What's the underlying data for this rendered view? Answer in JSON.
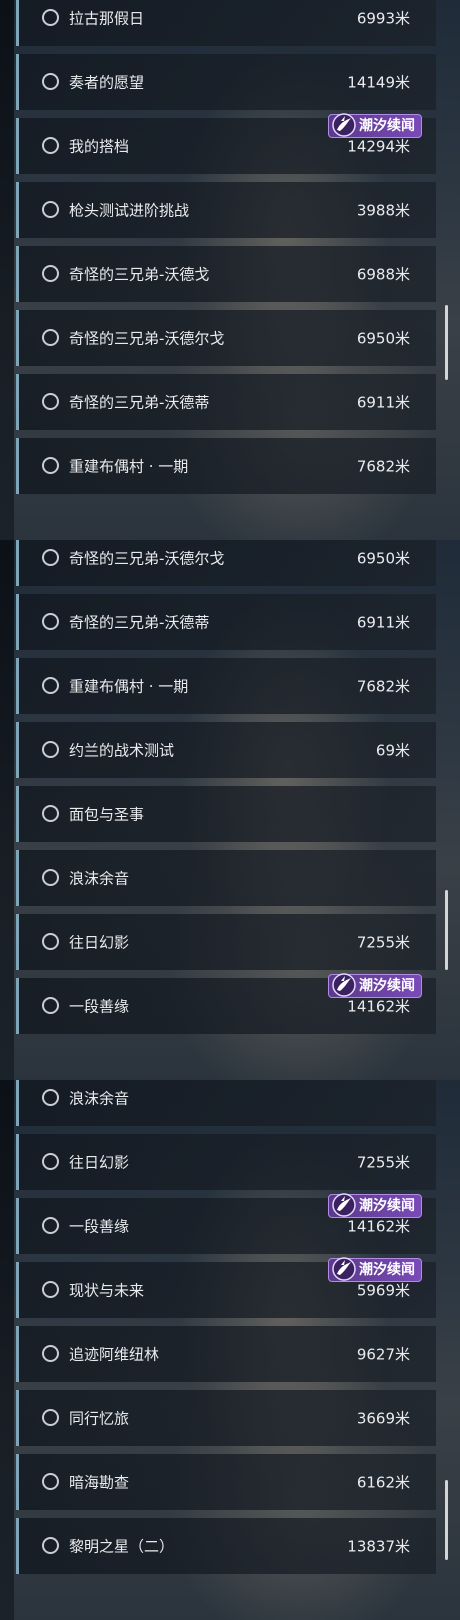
{
  "panels": [
    {
      "rows": [
        {
          "name": "拉古那假日",
          "distance": "6993米"
        },
        {
          "name": "奏者的愿望",
          "distance": "14149米"
        },
        {
          "name": "我的搭档",
          "distance": "14294米",
          "badge": "潮汐续闻"
        },
        {
          "name": "枪头测试进阶挑战",
          "distance": "3988米"
        },
        {
          "name": "奇怪的三兄弟-沃德戈",
          "distance": "6988米"
        },
        {
          "name": "奇怪的三兄弟-沃德尔戈",
          "distance": "6950米"
        },
        {
          "name": "奇怪的三兄弟-沃德蒂",
          "distance": "6911米"
        },
        {
          "name": "重建布偶村 · 一期",
          "distance": "7682米"
        }
      ]
    },
    {
      "rows": [
        {
          "name": "奇怪的三兄弟-沃德尔戈",
          "distance": "6950米"
        },
        {
          "name": "奇怪的三兄弟-沃德蒂",
          "distance": "6911米"
        },
        {
          "name": "重建布偶村 · 一期",
          "distance": "7682米"
        },
        {
          "name": "约兰的战术测试",
          "distance": "69米"
        },
        {
          "name": "面包与圣事",
          "distance": ""
        },
        {
          "name": "浪沫余音",
          "distance": ""
        },
        {
          "name": "往日幻影",
          "distance": "7255米"
        },
        {
          "name": "一段善缘",
          "distance": "14162米",
          "badge": "潮汐续闻"
        }
      ]
    },
    {
      "rows": [
        {
          "name": "浪沫余音",
          "distance": ""
        },
        {
          "name": "往日幻影",
          "distance": "7255米"
        },
        {
          "name": "一段善缘",
          "distance": "14162米",
          "badge": "潮汐续闻"
        },
        {
          "name": "现状与未来",
          "distance": "5969米",
          "badge": "潮汐续闻"
        },
        {
          "name": "追迹阿维纽林",
          "distance": "9627米"
        },
        {
          "name": "同行忆旅",
          "distance": "3669米"
        },
        {
          "name": "暗海勘查",
          "distance": "6162米"
        },
        {
          "name": "黎明之星（二）",
          "distance": "13837米"
        }
      ]
    }
  ],
  "colors": {
    "row_accent": "#7fa5b8",
    "badge_bg": "#6a42a0",
    "text": "#e9ebee"
  },
  "icons": {
    "row_marker": "radio-circle-icon",
    "badge_mark": "tide-swirl-icon"
  }
}
